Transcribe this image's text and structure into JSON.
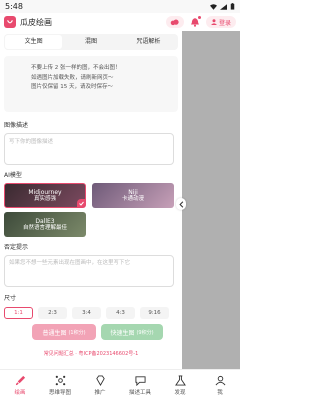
{
  "status": {
    "time": "5:48"
  },
  "app": {
    "title": "瓜皮绘画",
    "login_label": "登录"
  },
  "tabs": [
    {
      "label": "文生图"
    },
    {
      "label": "混图"
    },
    {
      "label": "咒语解析"
    }
  ],
  "notice": {
    "lines": [
      "不要上传 2 张一样的图，不会出图！",
      "如遇图片加载失败，请刷新网页～",
      "图片仅保留 15 天，请及时保存～"
    ]
  },
  "description": {
    "label": "图像描述",
    "placeholder": "写下你的图像描述"
  },
  "models": {
    "label": "AI模型",
    "items": [
      {
        "name": "Midjourney",
        "subtitle": "真实感强"
      },
      {
        "name": "Niji",
        "subtitle": "卡通动漫"
      },
      {
        "name": "DallE3",
        "subtitle": "自然语言理解最佳"
      }
    ]
  },
  "negative": {
    "label": "否定提示",
    "placeholder": "如果您不想一些元素出现在图画中，在这里写下它"
  },
  "size": {
    "label": "尺寸",
    "options": [
      "1:1",
      "2:3",
      "3:4",
      "4:3",
      "9:16"
    ],
    "selected": "1:1"
  },
  "generate": {
    "normal_label": "普通生图",
    "normal_cost": "(1积分)",
    "fast_label": "快速生图",
    "fast_cost": "(9积分)"
  },
  "footer": {
    "text": "常见问题汇总 · 粤ICP备2023146602号-1"
  },
  "bottom_nav": [
    {
      "label": "绘画",
      "icon": "paint-brush-icon"
    },
    {
      "label": "思维导图",
      "icon": "mind-map-icon"
    },
    {
      "label": "推广",
      "icon": "diamond-icon"
    },
    {
      "label": "描述工具",
      "icon": "chat-icon"
    },
    {
      "label": "发现",
      "icon": "flask-icon"
    },
    {
      "label": "我",
      "icon": "person-icon"
    }
  ],
  "colors": {
    "accent": "#e84a6e",
    "fast_button": "#a5d7b0",
    "normal_button": "#f2a3b6",
    "overlay": "#b0b0b0"
  }
}
